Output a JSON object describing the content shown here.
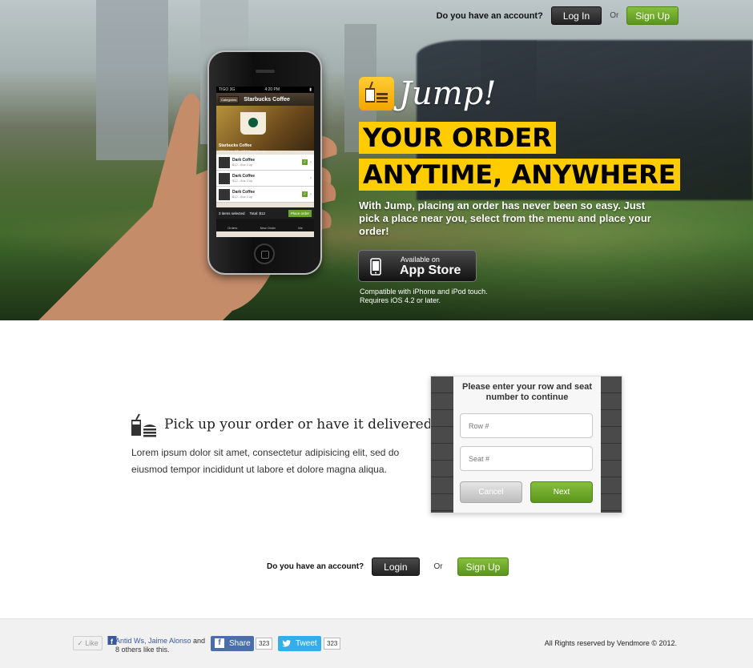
{
  "header": {
    "account_question": "Do you have an account?",
    "login_label": "Log In",
    "or_label": "Or",
    "signup_label": "Sign Up"
  },
  "brand": {
    "logo_name": "Jump!",
    "accent_color": "#ffcc00",
    "green_color": "#6aa22f"
  },
  "hero": {
    "headline_line1": "YOUR ORDER",
    "headline_line2": "ANYTIME, ANYWHERE",
    "description": "With Jump, placing an order has never been so easy. Just pick a place near you, select from the menu and place your order!",
    "appstore_small": "Available on",
    "appstore_big": "App Store",
    "compat_line1": "Compatible with iPhone and iPod touch.",
    "compat_line2": "Requires iOS 4.2 or later."
  },
  "phone_screen": {
    "carrier": "TIGO 3G",
    "time": "4:20 PM",
    "categories_label": "Categories",
    "nav_title": "Starbucks Coffee",
    "banner_title": "Starbucks Coffee",
    "banner_sub": "1234 Main ST - 124 Menu items",
    "items": [
      {
        "name": "Dark Coffee",
        "sub": "$12 - 8oz Cup",
        "qty": "2"
      },
      {
        "name": "Dark Coffee",
        "sub": "$12 - 8oz Cup",
        "qty": ""
      },
      {
        "name": "Dark Coffee",
        "sub": "$12 - 8oz Cup",
        "qty": "2"
      }
    ],
    "summary_count": "3 items selected",
    "summary_total": "Total: $12",
    "place_order": "Place order",
    "tabs": [
      "Orders",
      "New Order",
      "Me"
    ]
  },
  "feature": {
    "title": "Pick up your order or have it delivered",
    "text": "Lorem ipsum dolor sit amet, consectetur adipisicing elit, sed do eiusmod tempor incididunt ut labore et dolore magna aliqua."
  },
  "dialog": {
    "prompt": "Please enter your row and seat number to continue",
    "row_placeholder": "Row #",
    "seat_placeholder": "Seat #",
    "cancel_label": "Cancel",
    "next_label": "Next"
  },
  "mid_auth": {
    "account_question": "Do you have an account?",
    "login_label": "Login",
    "or_label": "Or",
    "signup_label": "Sign Up"
  },
  "footer": {
    "like_label": "Like",
    "like_names": "Antid Ws, Jaime Alonso",
    "like_rest": " and 8 others like this.",
    "share_label": "Share",
    "share_count": "323",
    "tweet_label": "Tweet",
    "tweet_count": "323",
    "copyright": "All Rights reserved by Vendmore © 2012."
  }
}
